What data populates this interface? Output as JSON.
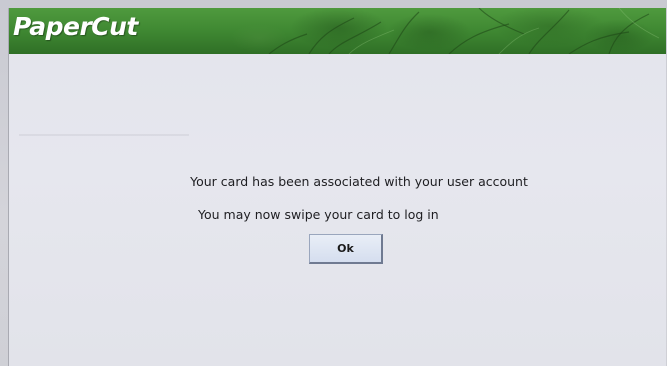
{
  "header": {
    "logo_text": "PaperCut",
    "accent_color": "#3f8832"
  },
  "dialog": {
    "message_line_1": "Your card has been associated with your user account",
    "message_line_2": "You may now swipe your card to log in",
    "ok_label": "Ok"
  }
}
